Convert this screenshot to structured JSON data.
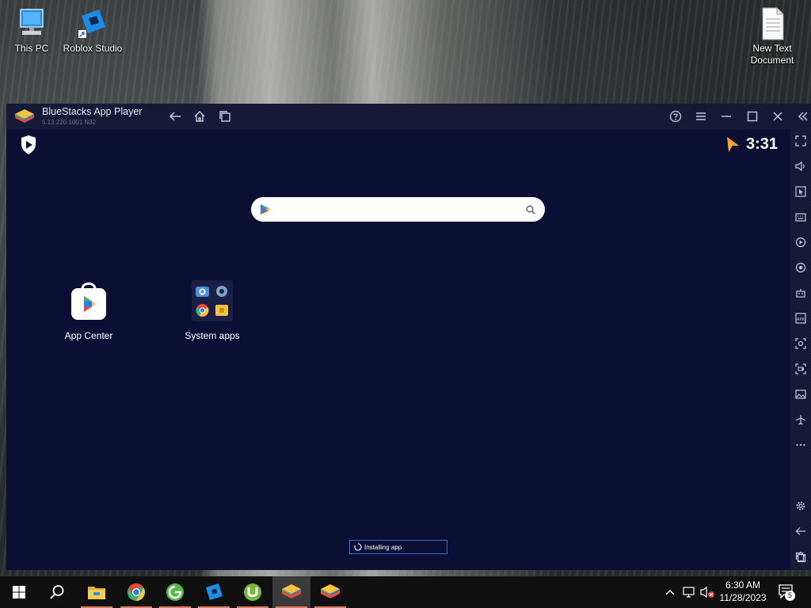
{
  "desktop": {
    "icons": [
      {
        "label": "This PC",
        "icon": "computer-icon"
      },
      {
        "label": "Roblox Studio",
        "icon": "roblox-studio-icon"
      },
      {
        "label": "New Text Document",
        "icon": "text-file-icon"
      }
    ]
  },
  "bluestacks": {
    "title": "BlueStacks App Player",
    "version": "5.13.220.1001 N32",
    "clock": "3:31",
    "search": {
      "placeholder": ""
    },
    "apps": [
      {
        "label": "App Center",
        "icon": "app-center-icon"
      },
      {
        "label": "System apps",
        "icon": "system-apps-folder-icon"
      }
    ],
    "status": "Installing app",
    "sidebar_tools": [
      "fullscreen-icon",
      "volume-icon",
      "pointer-icon",
      "keyboard-icon",
      "macro-icon",
      "record-icon",
      "game-controls-icon",
      "apk-install-icon",
      "screenshot-icon",
      "screen-record-icon",
      "media-manager-icon",
      "airplane-mode-icon",
      "more-icon",
      "settings-icon",
      "back-icon",
      "home-icon",
      "recents-icon"
    ]
  },
  "taskbar": {
    "time": "6:30 AM",
    "date": "11/28/2023",
    "notification_count": "5",
    "apps": [
      "start-icon",
      "search-icon",
      "file-explorer-icon",
      "chrome-icon",
      "green-browser-icon",
      "roblox-studio-icon",
      "utorrent-icon",
      "bluestacks-icon",
      "bluestacks-icon"
    ]
  },
  "colors": {
    "accent": "#3b6fd8",
    "screen_bg": "#0b0f33",
    "titlebar": "#171a36",
    "clock_arrow": "#f5a623"
  }
}
